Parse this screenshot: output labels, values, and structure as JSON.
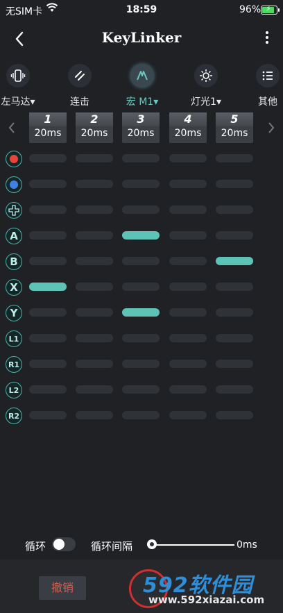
{
  "status": {
    "carrier": "无SIM卡",
    "time": "18:59",
    "battery_text": "96%",
    "battery_level": 0.96
  },
  "header": {
    "title": "KeyLinker"
  },
  "toolbar": [
    {
      "name": "motor",
      "label": "左马达▾",
      "icon": "vibration-icon",
      "active": false
    },
    {
      "name": "rapid-fire",
      "label": "连击",
      "icon": "rapid-fire-icon",
      "active": false
    },
    {
      "name": "macro",
      "label": "宏 M1▾",
      "icon": "macro-icon",
      "active": true
    },
    {
      "name": "light",
      "label": "灯光1▾",
      "icon": "light-icon",
      "active": false
    },
    {
      "name": "other",
      "label": "其他",
      "icon": "list-icon",
      "active": false
    }
  ],
  "columns": [
    {
      "num": "1",
      "ms": "20ms"
    },
    {
      "num": "2",
      "ms": "20ms"
    },
    {
      "num": "3",
      "ms": "20ms"
    },
    {
      "num": "4",
      "ms": "20ms"
    },
    {
      "num": "5",
      "ms": "20ms"
    }
  ],
  "rows": [
    {
      "key": "red",
      "icon": "red-button-icon",
      "label": "",
      "active": []
    },
    {
      "key": "blue",
      "icon": "blue-button-icon",
      "label": "",
      "active": []
    },
    {
      "key": "dpad",
      "icon": "dpad-icon",
      "label": "",
      "active": []
    },
    {
      "key": "A",
      "icon": "a-button-icon",
      "label": "A",
      "active": [
        3
      ]
    },
    {
      "key": "B",
      "icon": "b-button-icon",
      "label": "B",
      "active": [
        5
      ]
    },
    {
      "key": "X",
      "icon": "x-button-icon",
      "label": "X",
      "active": [
        1
      ]
    },
    {
      "key": "Y",
      "icon": "y-button-icon",
      "label": "Y",
      "active": [
        3
      ]
    },
    {
      "key": "L1",
      "icon": "l1-button-icon",
      "label": "L1",
      "active": []
    },
    {
      "key": "R1",
      "icon": "r1-button-icon",
      "label": "R1",
      "active": []
    },
    {
      "key": "L2",
      "icon": "l2-button-icon",
      "label": "L2",
      "active": []
    },
    {
      "key": "R2",
      "icon": "r2-button-icon",
      "label": "R2",
      "active": []
    }
  ],
  "colors": {
    "accent": "#5dc3b7",
    "cell": "#2f3237",
    "background": "#1f2125"
  },
  "bottom": {
    "loop_label": "循环",
    "loop_enabled": false,
    "interval_label": "循环间隔",
    "interval_value": "0ms",
    "interval_slider": 0
  },
  "footer": {
    "undo_label": "撤销",
    "watermark_brand": "592软件园",
    "watermark_url": "www.592xiazai.com"
  }
}
